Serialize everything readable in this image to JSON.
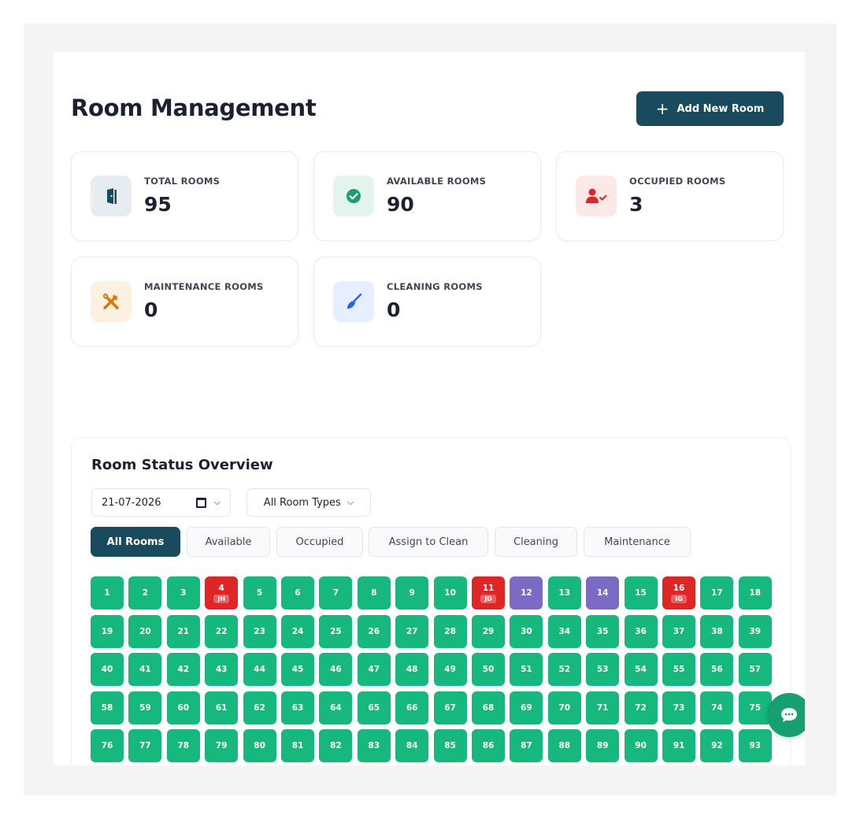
{
  "page": {
    "title": "Room Management",
    "add_button": "Add New Room"
  },
  "stats": [
    {
      "label": "TOTAL ROOMS",
      "value": "95",
      "icon": "door-icon",
      "color": "#194a5e"
    },
    {
      "label": "AVAILABLE ROOMS",
      "value": "90",
      "icon": "check-circle-icon",
      "color": "#16a06f"
    },
    {
      "label": "OCCUPIED ROOMS",
      "value": "3",
      "icon": "user-check-icon",
      "color": "#df2626"
    },
    {
      "label": "MAINTENANCE ROOMS",
      "value": "0",
      "icon": "tools-icon",
      "color": "#d97706"
    },
    {
      "label": "CLEANING ROOMS",
      "value": "0",
      "icon": "broom-icon",
      "color": "#2563eb"
    }
  ],
  "overview": {
    "title": "Room Status Overview",
    "date": "21-07-2026",
    "room_type": "All Room Types",
    "tabs": [
      "All Rooms",
      "Available",
      "Occupied",
      "Assign to Clean",
      "Cleaning",
      "Maintenance"
    ],
    "active_tab": "All Rooms"
  },
  "status_colors": {
    "available": "#16b87e",
    "occupied": "#df2626",
    "purple": "#7b6bc4"
  },
  "rooms": [
    {
      "n": "1",
      "s": "available"
    },
    {
      "n": "2",
      "s": "available"
    },
    {
      "n": "3",
      "s": "available"
    },
    {
      "n": "4",
      "s": "occupied",
      "i": "JH"
    },
    {
      "n": "5",
      "s": "available"
    },
    {
      "n": "6",
      "s": "available"
    },
    {
      "n": "7",
      "s": "available"
    },
    {
      "n": "8",
      "s": "available"
    },
    {
      "n": "9",
      "s": "available"
    },
    {
      "n": "10",
      "s": "available"
    },
    {
      "n": "11",
      "s": "occupied",
      "i": "JD"
    },
    {
      "n": "12",
      "s": "purple"
    },
    {
      "n": "13",
      "s": "available"
    },
    {
      "n": "14",
      "s": "purple"
    },
    {
      "n": "15",
      "s": "available"
    },
    {
      "n": "16",
      "s": "occupied",
      "i": "IG"
    },
    {
      "n": "17",
      "s": "available"
    },
    {
      "n": "18",
      "s": "available"
    },
    {
      "n": "19",
      "s": "available"
    },
    {
      "n": "20",
      "s": "available"
    },
    {
      "n": "21",
      "s": "available"
    },
    {
      "n": "22",
      "s": "available"
    },
    {
      "n": "23",
      "s": "available"
    },
    {
      "n": "24",
      "s": "available"
    },
    {
      "n": "25",
      "s": "available"
    },
    {
      "n": "26",
      "s": "available"
    },
    {
      "n": "27",
      "s": "available"
    },
    {
      "n": "28",
      "s": "available"
    },
    {
      "n": "29",
      "s": "available"
    },
    {
      "n": "30",
      "s": "available"
    },
    {
      "n": "34",
      "s": "available"
    },
    {
      "n": "35",
      "s": "available"
    },
    {
      "n": "36",
      "s": "available"
    },
    {
      "n": "37",
      "s": "available"
    },
    {
      "n": "38",
      "s": "available"
    },
    {
      "n": "39",
      "s": "available"
    },
    {
      "n": "40",
      "s": "available"
    },
    {
      "n": "41",
      "s": "available"
    },
    {
      "n": "42",
      "s": "available"
    },
    {
      "n": "43",
      "s": "available"
    },
    {
      "n": "44",
      "s": "available"
    },
    {
      "n": "45",
      "s": "available"
    },
    {
      "n": "46",
      "s": "available"
    },
    {
      "n": "47",
      "s": "available"
    },
    {
      "n": "48",
      "s": "available"
    },
    {
      "n": "49",
      "s": "available"
    },
    {
      "n": "50",
      "s": "available"
    },
    {
      "n": "51",
      "s": "available"
    },
    {
      "n": "52",
      "s": "available"
    },
    {
      "n": "53",
      "s": "available"
    },
    {
      "n": "54",
      "s": "available"
    },
    {
      "n": "55",
      "s": "available"
    },
    {
      "n": "56",
      "s": "available"
    },
    {
      "n": "57",
      "s": "available"
    },
    {
      "n": "58",
      "s": "available"
    },
    {
      "n": "59",
      "s": "available"
    },
    {
      "n": "60",
      "s": "available"
    },
    {
      "n": "61",
      "s": "available"
    },
    {
      "n": "62",
      "s": "available"
    },
    {
      "n": "63",
      "s": "available"
    },
    {
      "n": "64",
      "s": "available"
    },
    {
      "n": "65",
      "s": "available"
    },
    {
      "n": "66",
      "s": "available"
    },
    {
      "n": "67",
      "s": "available"
    },
    {
      "n": "68",
      "s": "available"
    },
    {
      "n": "69",
      "s": "available"
    },
    {
      "n": "70",
      "s": "available"
    },
    {
      "n": "71",
      "s": "available"
    },
    {
      "n": "72",
      "s": "available"
    },
    {
      "n": "73",
      "s": "available"
    },
    {
      "n": "74",
      "s": "available"
    },
    {
      "n": "75",
      "s": "available"
    },
    {
      "n": "76",
      "s": "available"
    },
    {
      "n": "77",
      "s": "available"
    },
    {
      "n": "78",
      "s": "available"
    },
    {
      "n": "79",
      "s": "available"
    },
    {
      "n": "80",
      "s": "available"
    },
    {
      "n": "81",
      "s": "available"
    },
    {
      "n": "82",
      "s": "available"
    },
    {
      "n": "83",
      "s": "available"
    },
    {
      "n": "84",
      "s": "available"
    },
    {
      "n": "85",
      "s": "available"
    },
    {
      "n": "86",
      "s": "available"
    },
    {
      "n": "87",
      "s": "available"
    },
    {
      "n": "88",
      "s": "available"
    },
    {
      "n": "89",
      "s": "available"
    },
    {
      "n": "90",
      "s": "available"
    },
    {
      "n": "91",
      "s": "available"
    },
    {
      "n": "92",
      "s": "available"
    },
    {
      "n": "93",
      "s": "available"
    }
  ],
  "chat": {
    "icon": "chat-bubble-icon"
  }
}
